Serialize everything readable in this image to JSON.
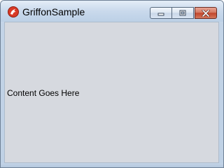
{
  "window": {
    "title": "GriffonSample",
    "icon": "griffon-app-icon",
    "controls": {
      "minimize": "minimize-icon",
      "maximize": "maximize-icon",
      "close": "close-icon"
    }
  },
  "content": {
    "text": "Content Goes Here"
  },
  "colors": {
    "client_background": "#d6d9df",
    "close_button": "#c2462c",
    "app_icon": "#d93a26"
  }
}
